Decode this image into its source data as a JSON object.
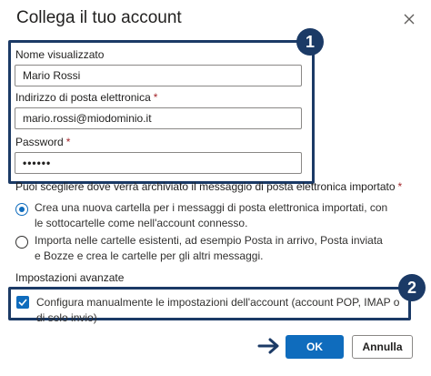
{
  "dialog": {
    "title": "Collega il tuo account"
  },
  "fields": {
    "display_name": {
      "label": "Nome visualizzato",
      "value": "Mario Rossi"
    },
    "email": {
      "label": "Indirizzo di posta elettronica",
      "required_mark": "*",
      "value": "mario.rossi@miodominio.it"
    },
    "password": {
      "label": "Password",
      "required_mark": "*",
      "value": "••••••"
    }
  },
  "import": {
    "question": "Puoi scegliere dove verrà archiviato il messaggio di posta elettronica importato",
    "required_mark": "*",
    "options": [
      {
        "label": "Crea una nuova cartella per i messaggi di posta elettronica importati, con le sottocartelle come nell'account connesso.",
        "selected": true
      },
      {
        "label": "Importa nelle cartelle esistenti, ad esempio Posta in arrivo, Posta inviata e Bozze e crea le cartelle per gli altri messaggi.",
        "selected": false
      }
    ]
  },
  "advanced": {
    "heading": "Impostazioni avanzate",
    "manual_config_label": "Configura manualmente le impostazioni dell'account (account POP, IMAP o di solo invio)",
    "manual_config_checked": true
  },
  "annotations": {
    "badge_1": "1",
    "badge_2": "2"
  },
  "buttons": {
    "ok": "OK",
    "cancel": "Annulla"
  },
  "colors": {
    "accent": "#0f6cbd",
    "annotation": "#1b3a66",
    "required": "#a4262c"
  }
}
